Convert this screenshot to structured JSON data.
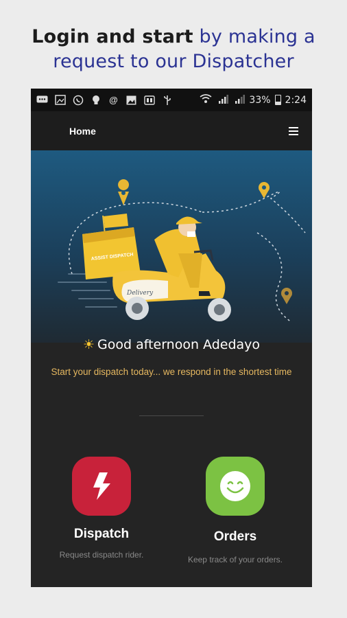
{
  "promo": {
    "headline_bold": "Login and start",
    "headline_rest": " by making a request to our Dispatcher",
    "colors": {
      "bold_text": "#1c1c1c",
      "accent_text": "#2b3393"
    }
  },
  "status_bar": {
    "left_icons": [
      "chat-icon",
      "image-icon",
      "whatsapp-icon",
      "bulb-icon",
      "at-icon",
      "gallery-icon",
      "sim-icon",
      "usb-icon"
    ],
    "wifi_icon": "wifi-icon",
    "signal_icons": [
      "signal-1-icon",
      "signal-2-icon"
    ],
    "battery": "33%",
    "time": "2:24"
  },
  "app_bar": {
    "title": "Home",
    "menu_icon": "hamburger-menu-icon"
  },
  "greeting": {
    "icon": "sun-icon",
    "text": "Good afternoon Adedayo",
    "subtitle": "Start your dispatch today... we respond in the shortest time"
  },
  "hero_art": {
    "box_label": "ASSIST DISPATCH",
    "scooter_label": "Delivery"
  },
  "actions": {
    "dispatch": {
      "title": "Dispatch",
      "desc": "Request dispatch rider.",
      "icon": "lightning-bolt-icon",
      "color": "#c8223a"
    },
    "orders": {
      "title": "Orders",
      "desc": "Keep track of your orders.",
      "icon": "smiley-icon",
      "color": "#7cc243"
    }
  }
}
